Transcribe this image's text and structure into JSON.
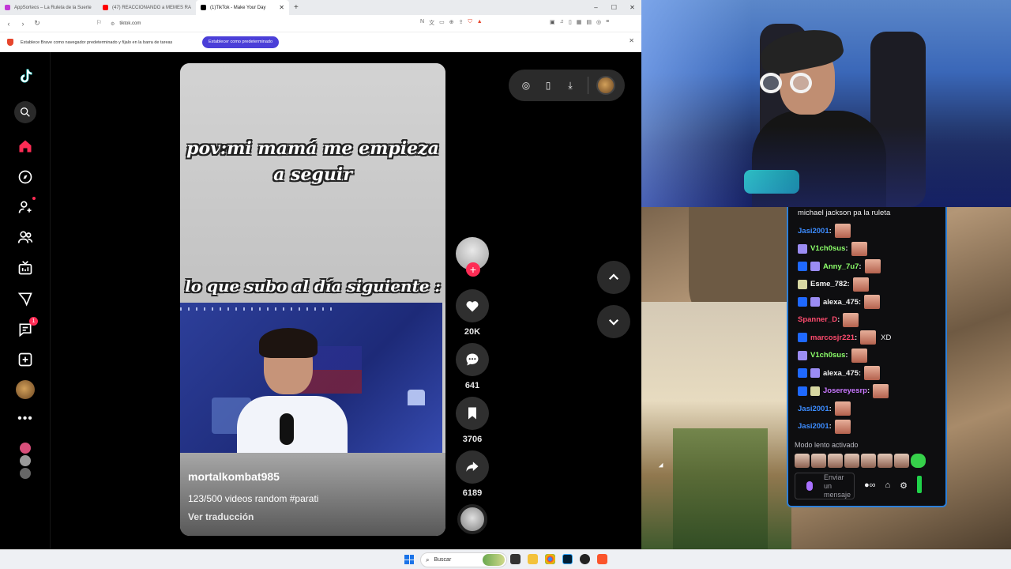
{
  "browser": {
    "tabs": [
      {
        "title": "AppSorteos – La Ruleta de la Suerte",
        "favicon_color": "#c238d6"
      },
      {
        "title": "(47) REACCIONANDO a MEMES RA",
        "favicon_color": "#ff0000"
      },
      {
        "title": "(1)TikTok - Make Your Day",
        "favicon_color": "#000000",
        "active": true
      }
    ],
    "new_tab": "+",
    "url": "tiktok.com",
    "window_controls": {
      "minimize": "–",
      "maximize": "☐",
      "close": "✕"
    },
    "infobar": {
      "message": "Establece Brave como navegador predeterminado y fíjalo en la barra de tareas",
      "button": "Establecer como predeterminado",
      "close": "✕"
    }
  },
  "tiktok": {
    "sidebar": [
      {
        "icon": "tiktok-logo-icon"
      },
      {
        "icon": "search-icon"
      },
      {
        "icon": "home-icon",
        "color": "#fe2c55"
      },
      {
        "icon": "explore-icon"
      },
      {
        "icon": "following-icon"
      },
      {
        "icon": "friends-icon"
      },
      {
        "icon": "live-icon"
      },
      {
        "icon": "messages-icon"
      },
      {
        "icon": "inbox-icon",
        "badge": "1"
      },
      {
        "icon": "upload-icon"
      },
      {
        "icon": "profile-avatar"
      },
      {
        "icon": "more-icon"
      }
    ],
    "video": {
      "caption_top": "pov:mi mamá me empieza a seguir",
      "caption_mid": "lo que subo al día siguiente :",
      "author": "mortalkombat985",
      "description": "123/500 videos random #parati",
      "translate": "Ver traducción"
    },
    "actions": {
      "likes": "20K",
      "comments": "641",
      "saves": "3706",
      "shares": "6189"
    },
    "accent_color": "#fe2c55"
  },
  "chat": {
    "top_message": "michael jackson pa la ruleta",
    "messages": [
      {
        "user": "Jasi2001",
        "color": "#3c8cff",
        "badges": []
      },
      {
        "user": "V1ch0sus",
        "color": "#8cff6a",
        "badges": [
          "sub"
        ]
      },
      {
        "user": "Anny_7u7",
        "color": "#8cff6a",
        "badges": [
          "blue",
          "sub"
        ]
      },
      {
        "user": "Esme_782",
        "color": "#f2f2f2",
        "badges": [
          "sub2"
        ]
      },
      {
        "user": "alexa_475",
        "color": "#f2f2f2",
        "badges": [
          "blue",
          "sub"
        ]
      },
      {
        "user": "Spanner_D",
        "color": "#ff4b6e",
        "badges": []
      },
      {
        "user": "marcosjr221",
        "color": "#ff4b6e",
        "badges": [
          "blue"
        ],
        "text": "XD"
      },
      {
        "user": "V1ch0sus",
        "color": "#8cff6a",
        "badges": [
          "sub"
        ]
      },
      {
        "user": "alexa_475",
        "color": "#f2f2f2",
        "badges": [
          "blue",
          "sub"
        ]
      },
      {
        "user": "Josereyesrp",
        "color": "#c877ff",
        "badges": [
          "blue",
          "sub2"
        ]
      },
      {
        "user": "Jasi2001",
        "color": "#3c8cff",
        "badges": []
      },
      {
        "user": "Jasi2001",
        "color": "#3c8cff",
        "badges": []
      }
    ],
    "slow_mode": "Modo lento activado",
    "input_placeholder": "Enviar un mensaje"
  },
  "taskbar": {
    "search_label": "Buscar"
  }
}
